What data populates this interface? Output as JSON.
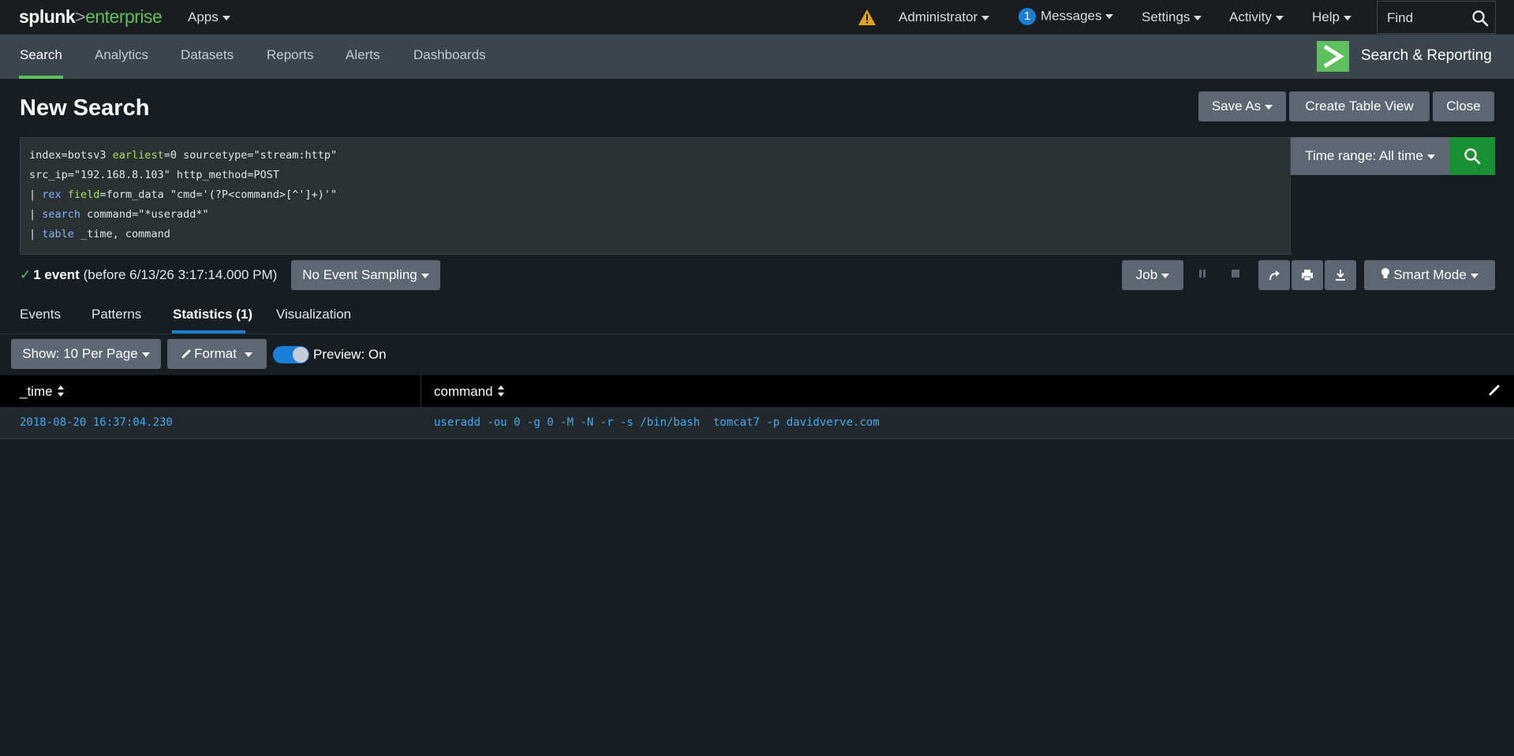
{
  "topbar": {
    "logo_part1": "splunk",
    "logo_part2": ">",
    "logo_part3": "enterprise",
    "apps": "Apps",
    "administrator": "Administrator",
    "messages_count": "1",
    "messages": "Messages",
    "settings": "Settings",
    "activity": "Activity",
    "help": "Help",
    "find": "Find"
  },
  "appbar": {
    "tabs": [
      "Search",
      "Analytics",
      "Datasets",
      "Reports",
      "Alerts",
      "Dashboards"
    ],
    "active_tab": "Search",
    "app_title": "Search & Reporting"
  },
  "header": {
    "title": "New Search",
    "save_as": "Save As",
    "create_table_view": "Create Table View",
    "close": "Close"
  },
  "search": {
    "line1": {
      "a": "index=botsv3 ",
      "b": "earliest",
      "c": "=0 sourcetype=\"stream:http\""
    },
    "line2": {
      "a": "src_ip=\"192.168.8.103\" http_method=POST"
    },
    "line3": {
      "a": "| ",
      "b": "rex",
      "c": " ",
      "d": "field",
      "e": "=form_data \"cmd='(?P<command>[^']+)'\""
    },
    "line4": {
      "a": "| ",
      "b": "search",
      "c": " command=\"*useradd*\""
    },
    "line5": {
      "a": "| ",
      "b": "table",
      "c": " _time, command"
    },
    "time_range": "Time range: All time"
  },
  "status": {
    "count": "1 event",
    "detail": "(before 6/13/26 3:17:14.000 PM)",
    "sampling": "No Event Sampling",
    "job": "Job",
    "mode": "Smart Mode"
  },
  "result_tabs": [
    "Events",
    "Patterns",
    "Statistics (1)",
    "Visualization"
  ],
  "active_result_tab": "Statistics (1)",
  "table_controls": {
    "show": "Show: 10 Per Page",
    "format": "Format",
    "preview": "Preview: On"
  },
  "table": {
    "columns": [
      "_time",
      "command"
    ],
    "rows": [
      [
        "2018-08-20 16:37:04.230",
        "useradd -ou 0 -g 0 -M -N -r -s /bin/bash  tomcat7 -p davidverve.com"
      ]
    ]
  },
  "colors": {
    "accent_green": "#5cc05c",
    "search_button": "#1a9035",
    "link_blue": "#3faaf2",
    "tab_underline": "#1a7fd6"
  }
}
